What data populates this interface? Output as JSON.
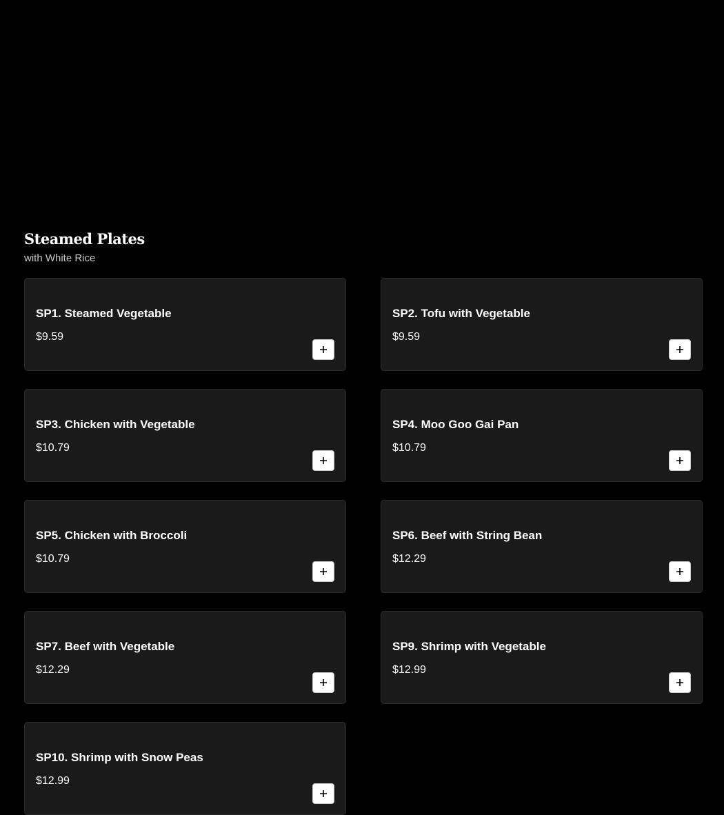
{
  "section": {
    "title": "Steamed Plates",
    "subtitle": "with White Rice"
  },
  "items": [
    {
      "name": "SP1. Steamed Vegetable",
      "price": "$9.59"
    },
    {
      "name": "SP2. Tofu with Vegetable",
      "price": "$9.59"
    },
    {
      "name": "SP3. Chicken with Vegetable",
      "price": "$10.79"
    },
    {
      "name": "SP4. Moo Goo Gai Pan",
      "price": "$10.79"
    },
    {
      "name": "SP5. Chicken with Broccoli",
      "price": "$10.79"
    },
    {
      "name": "SP6. Beef with String Bean",
      "price": "$12.29"
    },
    {
      "name": "SP7. Beef with Vegetable",
      "price": "$12.29"
    },
    {
      "name": "SP9. Shrimp with Vegetable",
      "price": "$12.99"
    },
    {
      "name": "SP10. Shrimp with Snow Peas",
      "price": "$12.99"
    }
  ],
  "icons": {
    "add": "plus-icon"
  },
  "colors": {
    "background": "#000000",
    "card": "#1a1a1a",
    "card_border": "#2c2c2c",
    "button": "#ffffff"
  }
}
